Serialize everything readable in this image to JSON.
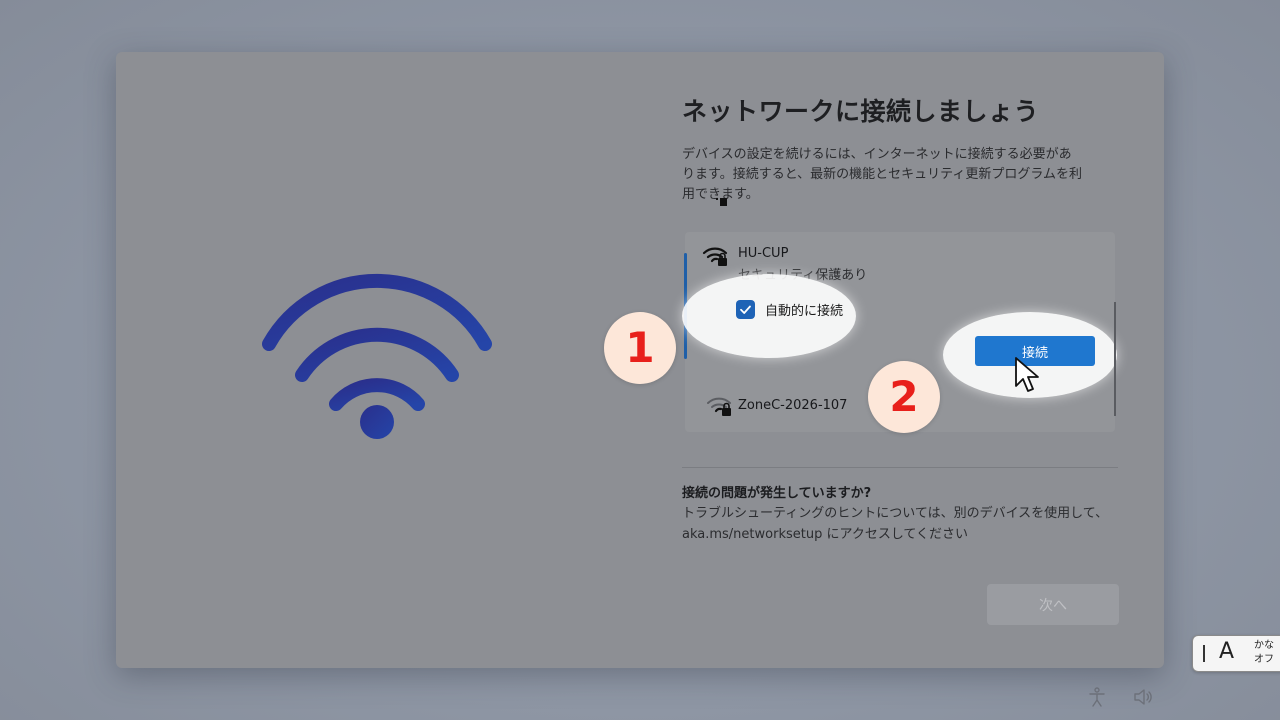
{
  "dialog": {
    "title": "ネットワークに接続しましょう",
    "subtitle": "デバイスの設定を続けるには、インターネットに接続する必要があります。接続すると、最新の機能とセキュリティ更新プログラムを利用できます。"
  },
  "networks": [
    {
      "name": "HU-CUP",
      "security": "セキュリティ保護あり",
      "auto_connect_label": "自動的に接続",
      "auto_connect_checked": true,
      "connect_label": "接続",
      "selected": true,
      "icon": "wifi-lock-icon"
    },
    {
      "name": "ZoneC-2026-107",
      "icon": "wifi-lock-icon"
    }
  ],
  "annotations": {
    "step1": "1",
    "step2": "2",
    "badge_color": "#e8201b"
  },
  "help": {
    "title": "接続の問題が発生していますか?",
    "body": "トラブルシューティングのヒントについては、別のデバイスを使用して、aka.ms/networksetup にアクセスしてください"
  },
  "next_label": "次へ",
  "ime": {
    "mode": "A",
    "kana": "かな",
    "state": "オフ"
  },
  "colors": {
    "accent": "#1f77cf",
    "wifi_art": "#27329a"
  }
}
